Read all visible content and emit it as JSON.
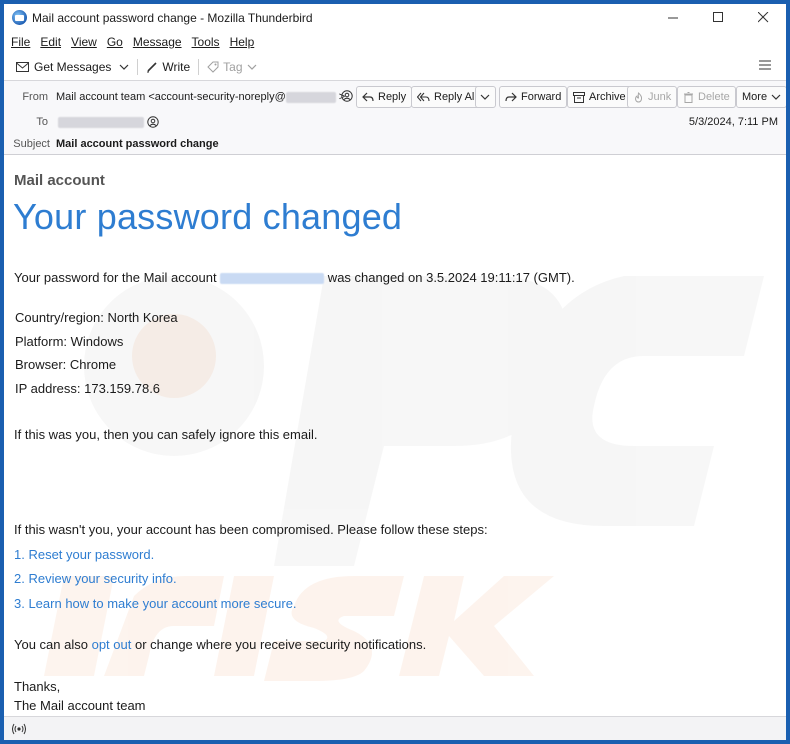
{
  "window": {
    "title": "Mail account password change - Mozilla Thunderbird"
  },
  "menubar": {
    "items": [
      "File",
      "Edit",
      "View",
      "Go",
      "Message",
      "Tools",
      "Help"
    ]
  },
  "toolbar": {
    "get_messages": "Get Messages",
    "write": "Write",
    "tag": "Tag"
  },
  "header": {
    "from_label": "From",
    "from_value": "Mail account team <account-security-noreply@",
    "to_label": "To",
    "subject_label": "Subject",
    "subject_value": "Mail account password change",
    "date": "5/3/2024, 7:11 PM",
    "buttons": {
      "reply": "Reply",
      "reply_all": "Reply All",
      "forward": "Forward",
      "archive": "Archive",
      "junk": "Junk",
      "delete": "Delete",
      "more": "More"
    }
  },
  "email": {
    "brand": "Mail account",
    "headline": "Your password changed",
    "intro_before": "Your password for the Mail account ",
    "intro_after": " was changed on 3.5.2024 19:11:17 (GMT).",
    "details": [
      "Country/region: North Korea",
      "Platform: Windows",
      "Browser: Chrome",
      "IP address: 173.159.78.6"
    ],
    "ignore_text": "If this was you, then you can safely ignore this email.",
    "compromised_text": "If this wasn't you, your account has been compromised. Please follow these steps:",
    "steps": [
      "1. Reset your password.",
      "2. Review your security info.",
      "3. Learn how to make your account more secure."
    ],
    "optout_before": "You can also ",
    "optout_link": "opt out",
    "optout_after": " or change where you receive security notifications.",
    "thanks": "Thanks,",
    "signature": "The Mail account team"
  },
  "colors": {
    "link": "#2e7dd1",
    "frame": "#1a5fb0"
  }
}
